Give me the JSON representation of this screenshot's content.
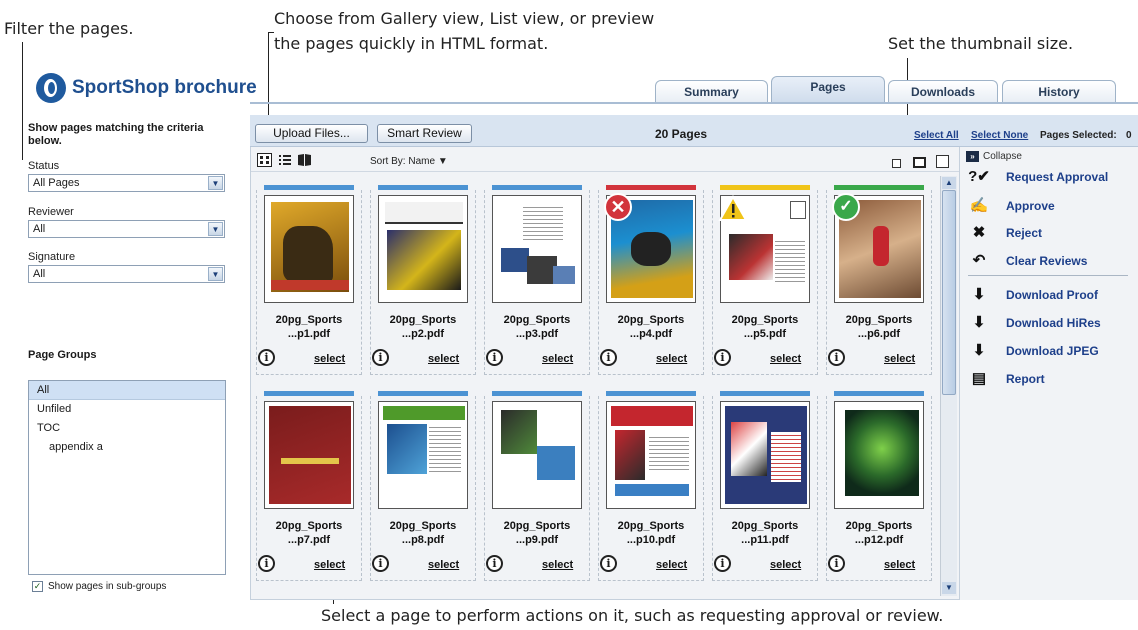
{
  "callouts": {
    "filter": "Filter the pages.",
    "views_line1": "Choose from Gallery view, List view, or preview",
    "views_line2": "the pages quickly in HTML format.",
    "thumb_size": "Set the thumbnail size.",
    "select_page": "Select a page to perform actions on it, such as requesting approval or review."
  },
  "app": {
    "title": "SportShop brochure"
  },
  "tabs": [
    {
      "label": "Summary"
    },
    {
      "label": "Pages",
      "active": true
    },
    {
      "label": "Downloads"
    },
    {
      "label": "History"
    }
  ],
  "filters": {
    "heading": "Show pages matching the criteria below.",
    "status_label": "Status",
    "status_value": "All Pages",
    "reviewer_label": "Reviewer",
    "reviewer_value": "All",
    "signature_label": "Signature",
    "signature_value": "All"
  },
  "page_groups": {
    "title": "Page Groups",
    "items": [
      "All",
      "Unfiled",
      "TOC",
      "appendix a"
    ],
    "show_subgroups_label": "Show pages in sub-groups",
    "show_subgroups_checked": true
  },
  "toolbar": {
    "upload_label": "Upload Files...",
    "smart_review_label": "Smart Review",
    "pages_count": "20 Pages",
    "select_all": "Select All",
    "select_none": "Select None",
    "pages_selected_label": "Pages Selected:",
    "pages_selected_value": "0",
    "sort_label": "Sort By:",
    "sort_value": "Name"
  },
  "pages": [
    {
      "name1": "20pg_Sports",
      "name2": "...p1.pdf",
      "status": "none",
      "bar": "#4c93d3"
    },
    {
      "name1": "20pg_Sports",
      "name2": "...p2.pdf",
      "status": "none",
      "bar": "#4c93d3"
    },
    {
      "name1": "20pg_Sports",
      "name2": "...p3.pdf",
      "status": "none",
      "bar": "#4c93d3"
    },
    {
      "name1": "20pg_Sports",
      "name2": "...p4.pdf",
      "status": "rejected",
      "bar": "#d2343c"
    },
    {
      "name1": "20pg_Sports",
      "name2": "...p5.pdf",
      "status": "warning",
      "bar": "#f0c419"
    },
    {
      "name1": "20pg_Sports",
      "name2": "...p6.pdf",
      "status": "approved",
      "bar": "#3aa84a"
    },
    {
      "name1": "20pg_Sports",
      "name2": "...p7.pdf",
      "status": "none",
      "bar": "#4c93d3"
    },
    {
      "name1": "20pg_Sports",
      "name2": "...p8.pdf",
      "status": "none",
      "bar": "#4c93d3"
    },
    {
      "name1": "20pg_Sports",
      "name2": "...p9.pdf",
      "status": "none",
      "bar": "#4c93d3"
    },
    {
      "name1": "20pg_Sports",
      "name2": "...p10.pdf",
      "status": "none",
      "bar": "#4c93d3"
    },
    {
      "name1": "20pg_Sports",
      "name2": "...p11.pdf",
      "status": "none",
      "bar": "#4c93d3"
    },
    {
      "name1": "20pg_Sports",
      "name2": "...p12.pdf",
      "status": "none",
      "bar": "#4c93d3"
    }
  ],
  "card_labels": {
    "select": "select",
    "info": "i"
  },
  "actions": {
    "collapse": "Collapse",
    "items": [
      {
        "label": "Request Approval",
        "icon": "request-approval-icon"
      },
      {
        "label": "Approve",
        "icon": "approve-icon"
      },
      {
        "label": "Reject",
        "icon": "reject-icon"
      },
      {
        "label": "Clear Reviews",
        "icon": "clear-reviews-icon"
      },
      {
        "label": "Download Proof",
        "icon": "download-proof-icon"
      },
      {
        "label": "Download HiRes",
        "icon": "download-hires-icon"
      },
      {
        "label": "Download JPEG",
        "icon": "download-jpeg-icon"
      },
      {
        "label": "Report",
        "icon": "report-icon"
      }
    ]
  },
  "colors": {
    "accent": "#1f4f8f",
    "toolbar": "#d9e4f1",
    "link": "#1d3f8a"
  }
}
